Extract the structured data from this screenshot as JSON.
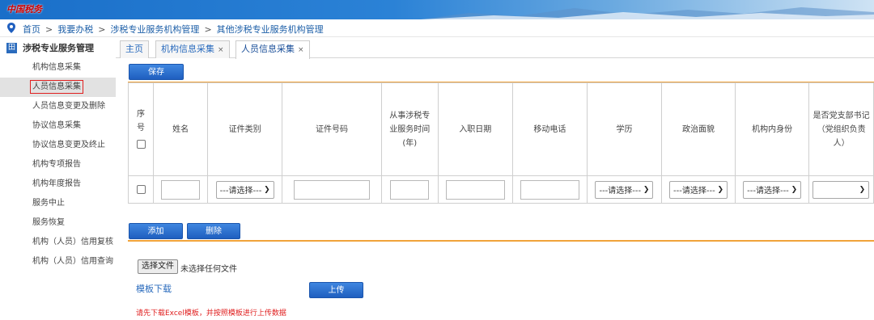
{
  "header": {
    "logo_text": "中国税务"
  },
  "breadcrumb": {
    "items": [
      "首页",
      "我要办税",
      "涉税专业服务机构管理",
      "其他涉税专业服务机构管理"
    ],
    "separator": ">"
  },
  "sidebar": {
    "title": "涉税专业服务管理",
    "title_icon": "田",
    "items": [
      {
        "label": "机构信息采集"
      },
      {
        "label": "人员信息采集",
        "active": true
      },
      {
        "label": "人员信息变更及删除"
      },
      {
        "label": "协议信息采集"
      },
      {
        "label": "协议信息变更及终止"
      },
      {
        "label": "机构专项报告"
      },
      {
        "label": "机构年度报告"
      },
      {
        "label": "服务中止"
      },
      {
        "label": "服务恢复"
      },
      {
        "label": "机构（人员）信用复核"
      },
      {
        "label": "机构（人员）信用查询"
      }
    ]
  },
  "tabs": [
    {
      "label": "主页",
      "closable": false
    },
    {
      "label": "机构信息采集",
      "closable": true
    },
    {
      "label": "人员信息采集",
      "closable": true,
      "active": true
    }
  ],
  "tab_close_glyph": "×",
  "toolbar": {
    "save_label": "保存"
  },
  "table": {
    "headers": {
      "seq": [
        "序",
        "号"
      ],
      "name": "姓名",
      "id_type": "证件类别",
      "id_number": "证件号码",
      "years": [
        "从事涉税专",
        "业服务时间",
        "(年)"
      ],
      "join_date": "入职日期",
      "mobile": "移动电话",
      "education": "学历",
      "political": "政治面貌",
      "role": "机构内身份",
      "party": [
        "是否党支部书记",
        "（党组织负责",
        "人）"
      ]
    },
    "select_placeholder": "---请选择---",
    "party_select_value": ""
  },
  "actions": {
    "add_label": "添加",
    "delete_label": "删除"
  },
  "upload": {
    "choose_file_label": "选择文件",
    "no_file_text": "未选择任何文件",
    "template_link": "模板下载",
    "upload_label": "上传",
    "note": "请先下载Excel模板，并按照模板进行上传数据"
  },
  "colors": {
    "accent": "#1f5fbf",
    "orange_line": "#f0a33a",
    "error_red": "#e02020",
    "link_blue": "#2a6bbd"
  }
}
